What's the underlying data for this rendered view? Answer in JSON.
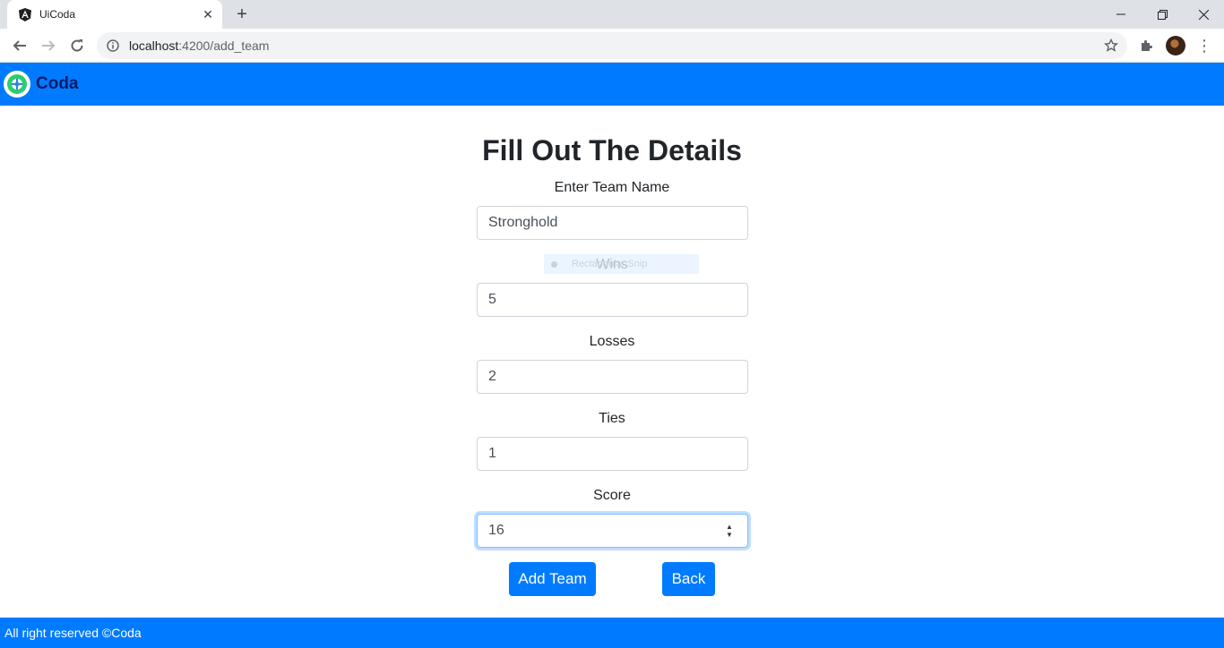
{
  "browser": {
    "tab_title": "UiCoda",
    "url_host": "localhost",
    "url_path": ":4200/add_team"
  },
  "navbar": {
    "brand": "Coda",
    "bg_color": "#007bff"
  },
  "form": {
    "heading": "Fill Out The Details",
    "fields": [
      {
        "label": "Enter Team Name",
        "value": "Stronghold"
      },
      {
        "label": "Wins",
        "value": "5"
      },
      {
        "label": "Losses",
        "value": "2"
      },
      {
        "label": "Ties",
        "value": "1"
      },
      {
        "label": "Score",
        "value": "16"
      }
    ],
    "add_button": "Add Team",
    "back_button": "Back"
  },
  "snip_overlay": {
    "text": "Rectangular Snip"
  },
  "footer": {
    "text": "All right reserved ©Coda"
  }
}
